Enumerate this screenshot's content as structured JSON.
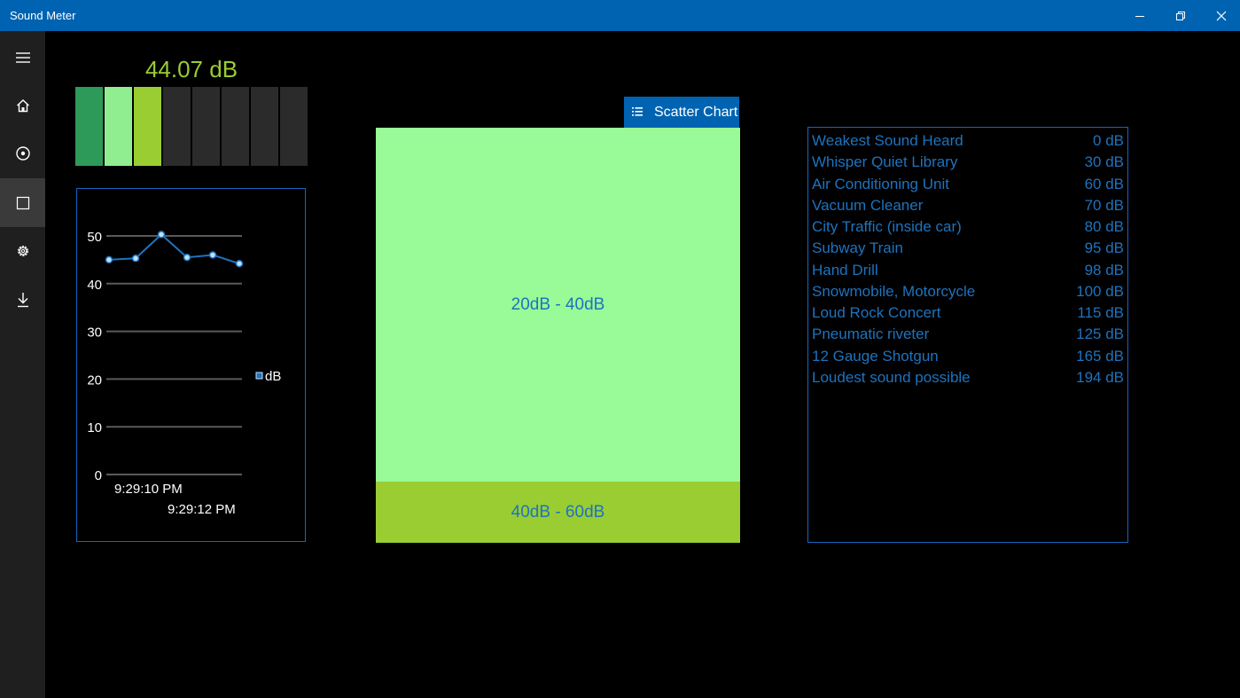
{
  "window": {
    "title": "Sound Meter",
    "accent": "#0063b1",
    "controls": [
      "minimize-icon",
      "restore-icon",
      "close-icon"
    ]
  },
  "sidebar": {
    "items": [
      {
        "icon": "hamburger-menu-icon",
        "selected": false
      },
      {
        "icon": "home-icon",
        "selected": false
      },
      {
        "icon": "record-icon",
        "selected": false
      },
      {
        "icon": "square-icon",
        "selected": true
      },
      {
        "icon": "gear-icon",
        "selected": false
      },
      {
        "icon": "download-icon",
        "selected": false
      }
    ]
  },
  "meter": {
    "readout": "44.07 dB",
    "lit_segments": 3,
    "total_segments": 8,
    "segment_colors": [
      "#2e9a5a",
      "#90ee90",
      "#9acd32"
    ]
  },
  "chart_data": {
    "type": "line",
    "x": [
      "",
      "9:29:10 PM",
      "",
      "9:29:12 PM",
      "",
      ""
    ],
    "values": [
      45,
      45.3,
      50.3,
      45.5,
      46,
      44.2
    ],
    "x_tick_labels": [
      "9:29:10 PM",
      "9:29:12 PM"
    ],
    "y_ticks": [
      0,
      10,
      20,
      30,
      40,
      50
    ],
    "ylim": [
      0,
      50
    ],
    "series": [
      {
        "name": "dB",
        "values": [
          45,
          45.3,
          50.3,
          45.5,
          46,
          44.2
        ]
      }
    ],
    "legend": "right",
    "grid": true,
    "series_color": "#1e73be"
  },
  "chart_button": {
    "label": "Scatter Chart",
    "icon": "list-icon"
  },
  "ranges": [
    {
      "label": "20dB - 40dB",
      "color": "#98fb98"
    },
    {
      "label": "40dB - 60dB",
      "color": "#9acd32"
    }
  ],
  "reference_list": [
    {
      "name": "Weakest Sound Heard",
      "value": "0 dB"
    },
    {
      "name": "Whisper Quiet Library",
      "value": "30 dB"
    },
    {
      "name": "Air Conditioning Unit",
      "value": "60 dB"
    },
    {
      "name": "Vacuum Cleaner",
      "value": "70 dB"
    },
    {
      "name": "City Traffic (inside car)",
      "value": "80 dB"
    },
    {
      "name": "Subway Train",
      "value": "95 dB"
    },
    {
      "name": "Hand Drill",
      "value": "98 dB"
    },
    {
      "name": "Snowmobile, Motorcycle",
      "value": "100 dB"
    },
    {
      "name": "Loud Rock Concert",
      "value": "115 dB"
    },
    {
      "name": "Pneumatic riveter",
      "value": "125 dB"
    },
    {
      "name": "12 Gauge Shotgun",
      "value": "165 dB"
    },
    {
      "name": "Loudest sound possible",
      "value": "194 dB"
    }
  ]
}
